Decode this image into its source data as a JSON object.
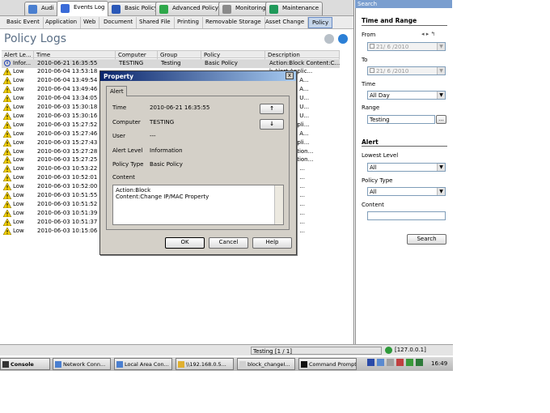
{
  "module_tabs": [
    "Audi",
    "Events Log",
    "Basic Policy",
    "Advanced Policy",
    "Monitoring",
    "Maintenance"
  ],
  "sub_tabs": [
    "Basic Event",
    "Application",
    "Web",
    "Document",
    "Shared File",
    "Printing",
    "Removable Storage",
    "Asset Change",
    "Policy"
  ],
  "page_title": "Policy Logs",
  "columns": [
    "Alert Le...",
    "Time",
    "Computer",
    "Group",
    "Policy",
    "Description"
  ],
  "rows": [
    {
      "level": "Infor...",
      "time": "2010-06-21 16:35:55",
      "computer": "TESTING",
      "group": "Testing",
      "policy": "Basic Policy",
      "desc": "Action:Block  Content:C...",
      "type": "info"
    },
    {
      "level": "Low",
      "time": "2010-06-04 13:53:18",
      "desc": "k,Alert  Applic...",
      "type": "warn"
    },
    {
      "level": "Low",
      "time": "2010-06-04 13:49:54",
      "desc": "k,Warning  A...",
      "type": "warn"
    },
    {
      "level": "Low",
      "time": "2010-06-04 13:49:46",
      "desc": "k,Warning  A...",
      "type": "warn"
    },
    {
      "level": "Low",
      "time": "2010-06-04 13:34:05",
      "desc": "k,Warning  U...",
      "type": "warn"
    },
    {
      "level": "Low",
      "time": "2010-06-03 15:30:18",
      "desc": "k,Warning  U...",
      "type": "warn"
    },
    {
      "level": "Low",
      "time": "2010-06-03 15:30:16",
      "desc": "k,Warning  U...",
      "type": "warn"
    },
    {
      "level": "Low",
      "time": "2010-06-03 15:27:52",
      "desc": "k,Alert  Appli...",
      "type": "warn"
    },
    {
      "level": "Low",
      "time": "2010-06-03 15:27:46",
      "desc": "k,Warning  A...",
      "type": "warn"
    },
    {
      "level": "Low",
      "time": "2010-06-03 15:27:43",
      "desc": "k,Alert  Appli...",
      "type": "warn"
    },
    {
      "level": "Low",
      "time": "2010-06-03 15:27:28",
      "desc": "k. Application...",
      "type": "warn"
    },
    {
      "level": "Low",
      "time": "2010-06-03 15:27:25",
      "desc": "k. Application...",
      "type": "warn"
    },
    {
      "level": "Low",
      "time": "2010-06-03 10:53:22",
      "desc": "k,Warning  ...",
      "type": "warn"
    },
    {
      "level": "Low",
      "time": "2010-06-03 10:52:01",
      "desc": "k,Warning  ...",
      "type": "warn"
    },
    {
      "level": "Low",
      "time": "2010-06-03 10:52:00",
      "desc": "k,Warning  ...",
      "type": "warn"
    },
    {
      "level": "Low",
      "time": "2010-06-03 10:51:55",
      "desc": "k,Warning  ...",
      "type": "warn"
    },
    {
      "level": "Low",
      "time": "2010-06-03 10:51:52",
      "desc": "k,Warning  ...",
      "type": "warn"
    },
    {
      "level": "Low",
      "time": "2010-06-03 10:51:39",
      "desc": "k,Warning  ...",
      "type": "warn"
    },
    {
      "level": "Low",
      "time": "2010-06-03 10:51:37",
      "desc": "k,Warning  ...",
      "type": "warn"
    },
    {
      "level": "Low",
      "time": "2010-06-03 10:15:06",
      "desc": "k,Warning  ...",
      "type": "warn"
    }
  ],
  "status": {
    "page": "Testing [1 / 1]",
    "server": "[127.0.0.1]"
  },
  "search": {
    "title": "Search",
    "time_range": "Time and Range",
    "from_label": "From",
    "from_value": "21/ 6 /2010",
    "to_label": "To",
    "to_value": "21/ 6 /2010",
    "time_label": "Time",
    "time_value": "All Day",
    "range_label": "Range",
    "range_value": "Testing",
    "range_btn": "...",
    "alert_section": "Alert",
    "lowest_label": "Lowest Level",
    "lowest_value": "All",
    "policy_type_label": "Policy Type",
    "policy_type_value": "All",
    "content_label": "Content",
    "content_value": "",
    "search_btn": "Search"
  },
  "dialog": {
    "title": "Property",
    "close": "x",
    "tab": "Alert",
    "time_label": "Time",
    "time_value": "2010-06-21 16:35:55",
    "computer_label": "Computer",
    "computer_value": "TESTING",
    "user_label": "User",
    "user_value": "---",
    "level_label": "Alert Level",
    "level_value": "Information",
    "ptype_label": "Policy Type",
    "ptype_value": "Basic Policy",
    "content_label": "Content",
    "content_line1": "Action:Block",
    "content_line2": "Content:Change IP/MAC Property",
    "up": "↑",
    "down": "↓",
    "ok": "OK",
    "cancel": "Cancel",
    "help": "Help"
  },
  "taskbar": {
    "start": "Console",
    "items": [
      "Network Conn...",
      "Local Area Con...",
      "\\\\192.168.0.5...",
      "block_changeI...",
      "Command Prompt"
    ],
    "clock": "16:49"
  }
}
